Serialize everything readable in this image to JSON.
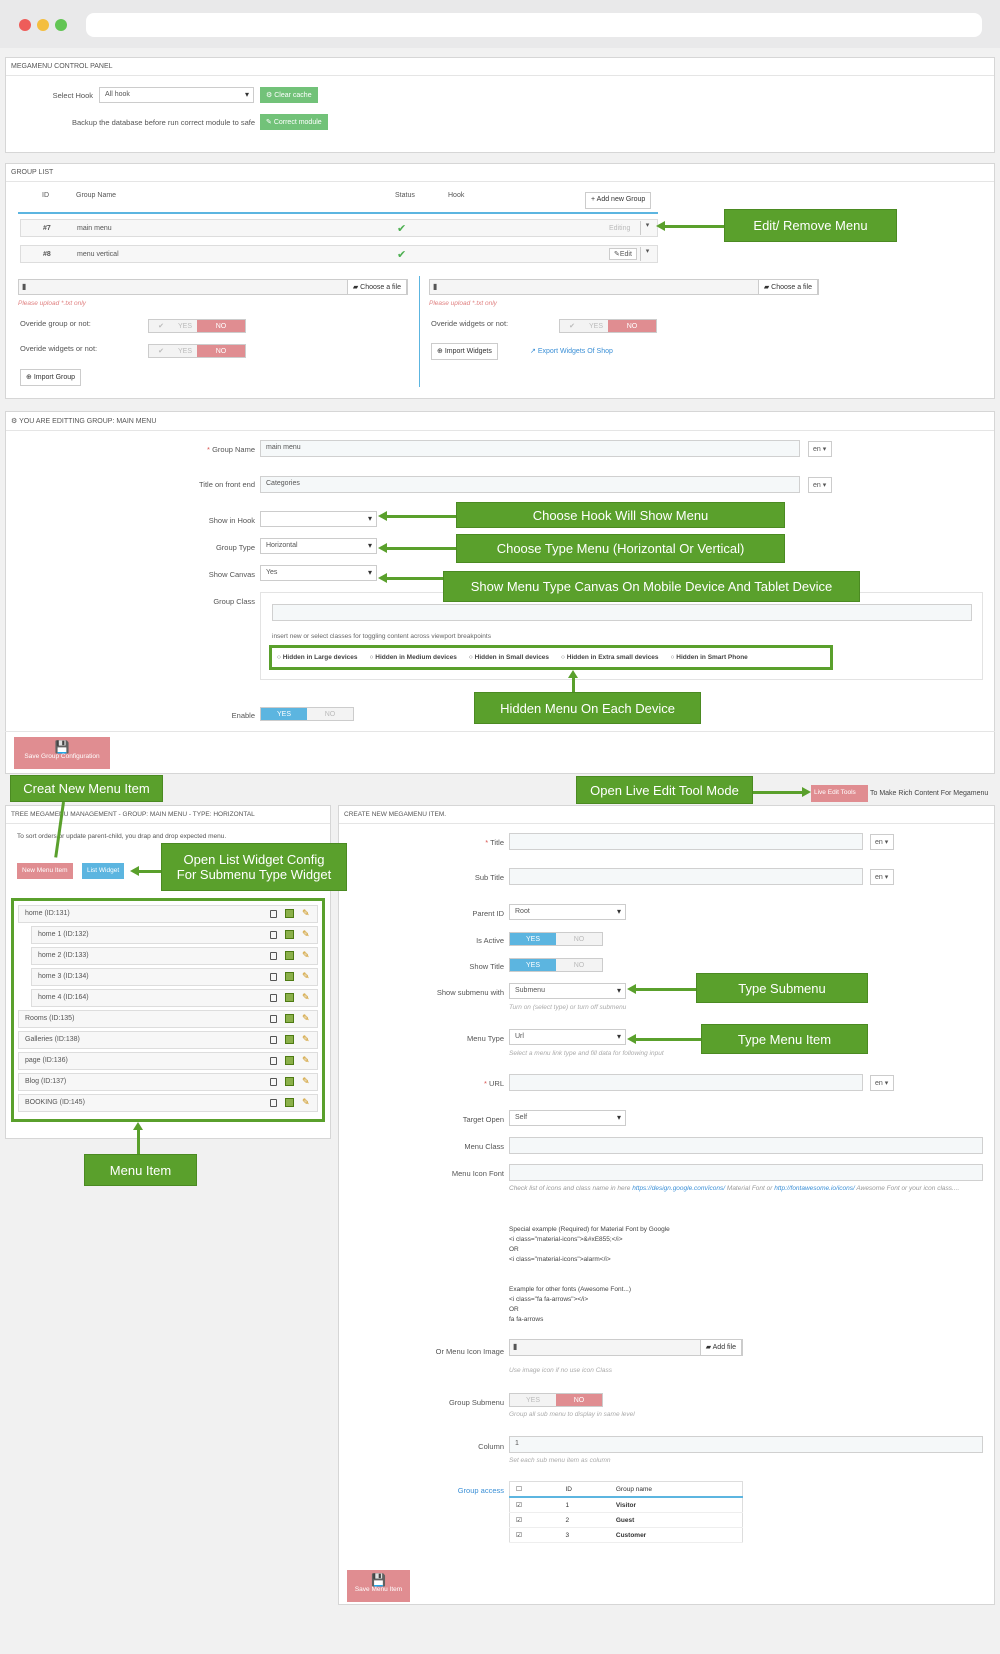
{
  "control_panel": {
    "title": "MEGAMENU CONTROL PANEL",
    "select_hook_label": "Select Hook",
    "select_hook_value": "All hook",
    "clear_cache": "Clear cache",
    "backup_text": "Backup the database before run correct module to safe",
    "correct_module": "Correct module"
  },
  "group_list": {
    "title": "GROUP LIST",
    "headers": {
      "id": "ID",
      "name": "Group Name",
      "status": "Status",
      "hook": "Hook"
    },
    "add_group": "Add new Group",
    "rows": [
      {
        "id": "#7",
        "name": "main menu",
        "action": "Editing"
      },
      {
        "id": "#8",
        "name": "menu vertical",
        "action": "Edit"
      }
    ],
    "choose_file": "Choose a file",
    "upload_warning": "Please upload *.txt only",
    "override_group": "Overide group or not:",
    "override_widgets": "Overide widgets or not:",
    "yes": "YES",
    "no": "NO",
    "import_group": "Import Group",
    "import_widgets": "Import Widgets",
    "export_widgets": "Export Widgets Of Shop"
  },
  "edit_group": {
    "title": "YOU ARE EDITTING GROUP: MAIN MENU",
    "group_name_label": "Group Name",
    "group_name_value": "main menu",
    "title_front_label": "Title on front end",
    "title_front_value": "Categories",
    "lang": "en",
    "show_in_hook": "Show in Hook",
    "group_type_label": "Group Type",
    "group_type_value": "Horizontal",
    "show_canvas_label": "Show Canvas",
    "show_canvas_value": "Yes",
    "group_class_label": "Group Class",
    "class_hint": "insert new or select classes for toggling content across viewport breakpoints",
    "hidden_options": [
      "Hidden in Large devices",
      "Hidden in Medium devices",
      "Hidden in Small devices",
      "Hidden in Extra small devices",
      "Hidden in Smart Phone"
    ],
    "enable_label": "Enable",
    "yes": "YES",
    "no": "NO",
    "save_label": "Save Group Configuration"
  },
  "tree": {
    "title": "TREE MEGAMENU MANAGEMENT - GROUP: MAIN MENU - TYPE: HORIZONTAL",
    "hint": "To sort orders or update parent-child, you drap and drop expected menu.",
    "new_item": "New Menu Item",
    "list_widget": "List Widget",
    "items": [
      {
        "label": "home (ID:131)",
        "child": false
      },
      {
        "label": "home 1 (ID:132)",
        "child": true
      },
      {
        "label": "home 2 (ID:133)",
        "child": true
      },
      {
        "label": "home 3 (ID:134)",
        "child": true
      },
      {
        "label": "home 4 (ID:164)",
        "child": true
      },
      {
        "label": "Rooms (ID:135)",
        "child": false
      },
      {
        "label": "Galleries (ID:138)",
        "child": false
      },
      {
        "label": "page (ID:136)",
        "child": false
      },
      {
        "label": "Blog (ID:137)",
        "child": false
      },
      {
        "label": "BOOKING (ID:145)",
        "child": false
      }
    ]
  },
  "live_edit": {
    "button": "Live Edit Tools",
    "text": "To Make Rich Content For Megamenu"
  },
  "create_item": {
    "title": "CREATE NEW MEGAMENU ITEM.",
    "title_label": "Title",
    "subtitle_label": "Sub Title",
    "parent_label": "Parent ID",
    "parent_value": "Root",
    "active_label": "Is Active",
    "show_title_label": "Show Title",
    "submenu_label": "Show submenu with",
    "submenu_value": "Submenu",
    "submenu_hint": "Turn on (select type) or turn off submenu",
    "menu_type_label": "Menu Type",
    "menu_type_value": "Url",
    "menu_type_hint": "Select a menu link type and fill data for following input",
    "url_label": "URL",
    "target_label": "Target Open",
    "target_value": "Self",
    "class_label": "Menu Class",
    "icon_font_label": "Menu Icon Font",
    "icon_hint_1": "Check list of icons and class name in here",
    "icon_link_1": "https://design.google.com/icons/",
    "icon_hint_2": "Material Font or",
    "icon_link_2": "http://fontawesome.io/icons/",
    "icon_hint_3": "Awesome Font or your icon class....",
    "special_title": "Special example (Required) for Material Font by Google",
    "special_l1": "<i class=\"material-icons\">&#xE855;</i>",
    "or1": "OR",
    "special_l2": "<i class=\"material-icons\">alarm</i>",
    "other_title": "Example for other fonts (Awesome Font...)",
    "other_l1": "<i class=\"fa fa-arrows\"></i>",
    "or2": "OR",
    "other_l2": "fa fa-arrows",
    "icon_image_label": "Or Menu Icon Image",
    "add_file": "Add file",
    "icon_image_hint": "Use image icon if no use icon Class",
    "group_sub_label": "Group Submenu",
    "group_sub_hint": "Group all sub menu to display in same level",
    "column_label": "Column",
    "column_value": "1",
    "column_hint": "Set each sub menu item as column",
    "access_label": "Group access",
    "access_headers": {
      "id": "ID",
      "name": "Group name"
    },
    "access_rows": [
      {
        "id": "1",
        "name": "Visitor"
      },
      {
        "id": "2",
        "name": "Guest"
      },
      {
        "id": "3",
        "name": "Customer"
      }
    ],
    "yes": "YES",
    "no": "NO",
    "lang": "en",
    "save_label": "Save Menu Item"
  },
  "annotations": {
    "edit_remove": "Edit/ Remove Menu",
    "hook": "Choose Hook Will Show Menu",
    "type": "Choose Type Menu (Horizontal Or Vertical)",
    "canvas": "Show Menu Type Canvas On Mobile Device And  Tablet Device",
    "hidden": "Hidden Menu On Each Device",
    "new_item": "Creat New Menu Item",
    "live_edit": "Open Live Edit Tool Mode",
    "list_widget_1": "Open List Widget Config",
    "list_widget_2": "For Submenu Type Widget",
    "type_submenu": "Type Submenu",
    "type_menu_item": "Type Menu Item",
    "menu_item": "Menu Item"
  },
  "colors": {
    "annotation_green": "#5aa02c",
    "yes_blue": "#5cb5e0",
    "no_red": "#e08d91",
    "button_green": "#72c279",
    "save_red": "#e08d91"
  }
}
